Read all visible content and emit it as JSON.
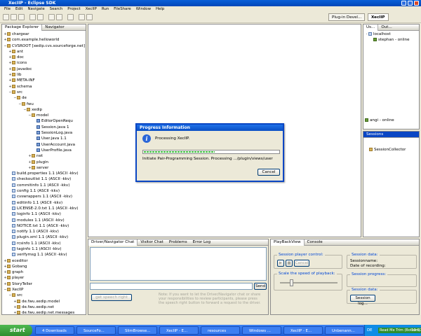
{
  "window": {
    "title": "XecIIP - Eclipse SDK"
  },
  "menu": [
    "File",
    "Edit",
    "Navigate",
    "Search",
    "Project",
    "XecIIP",
    "Run",
    "FileShare",
    "Window",
    "Help"
  ],
  "toolbar": {
    "perspective_active": "XecIIP",
    "perspective_other": "Plug-in Devel..."
  },
  "package_explorer": {
    "tabs": [
      "Package Explorer",
      "Navigator"
    ],
    "rows": [
      {
        "indent": 0,
        "exp": "+",
        "kind": "p",
        "label": "chargear"
      },
      {
        "indent": 0,
        "exp": "+",
        "kind": "p",
        "label": "com.example.helloworld"
      },
      {
        "indent": 0,
        "exp": "-",
        "kind": "p",
        "label": "CVSROOT  [xedip.cvs.sourceforge.net]"
      },
      {
        "indent": 1,
        "exp": "+",
        "kind": "p",
        "label": "ant"
      },
      {
        "indent": 1,
        "exp": "+",
        "kind": "p",
        "label": "doc"
      },
      {
        "indent": 1,
        "exp": "+",
        "kind": "p",
        "label": "icons"
      },
      {
        "indent": 1,
        "exp": "+",
        "kind": "p",
        "label": "javadoc"
      },
      {
        "indent": 1,
        "exp": "+",
        "kind": "p",
        "label": "lib"
      },
      {
        "indent": 1,
        "exp": "+",
        "kind": "p",
        "label": "META-INF"
      },
      {
        "indent": 1,
        "exp": "+",
        "kind": "p",
        "label": "schema"
      },
      {
        "indent": 1,
        "exp": "-",
        "kind": "p",
        "label": "src"
      },
      {
        "indent": 2,
        "exp": "-",
        "kind": "p",
        "label": "de"
      },
      {
        "indent": 3,
        "exp": "-",
        "kind": "p",
        "label": "fwu"
      },
      {
        "indent": 4,
        "exp": "-",
        "kind": "p",
        "label": "xedip"
      },
      {
        "indent": 5,
        "exp": "-",
        "kind": "p",
        "label": "model"
      },
      {
        "indent": 6,
        "exp": " ",
        "kind": "j",
        "label": "EditorOpenRequ"
      },
      {
        "indent": 6,
        "exp": " ",
        "kind": "j",
        "label": "Session.java 1"
      },
      {
        "indent": 6,
        "exp": " ",
        "kind": "j",
        "label": "SessionLog.java"
      },
      {
        "indent": 6,
        "exp": " ",
        "kind": "j",
        "label": "User.java 1.1"
      },
      {
        "indent": 6,
        "exp": " ",
        "kind": "j",
        "label": "UserAccount.java"
      },
      {
        "indent": 6,
        "exp": " ",
        "kind": "j",
        "label": "UserProfile.java"
      },
      {
        "indent": 5,
        "exp": "+",
        "kind": "p",
        "label": "net"
      },
      {
        "indent": 5,
        "exp": "+",
        "kind": "p",
        "label": "plugin"
      },
      {
        "indent": 5,
        "exp": "+",
        "kind": "p",
        "label": "server"
      },
      {
        "indent": 1,
        "exp": " ",
        "kind": "f",
        "label": "build.properties  1.1  (ASCII -kkv)"
      },
      {
        "indent": 1,
        "exp": " ",
        "kind": "f",
        "label": "checkoutlist  1.1  (ASCII -kkv)"
      },
      {
        "indent": 1,
        "exp": " ",
        "kind": "f",
        "label": "commitinfo  1.1  (ASCII -kkv)"
      },
      {
        "indent": 1,
        "exp": " ",
        "kind": "f",
        "label": "config  1.1  (ASCII -kkv)"
      },
      {
        "indent": 1,
        "exp": " ",
        "kind": "f",
        "label": "cvswrappers  1.1  (ASCII -kkv)"
      },
      {
        "indent": 1,
        "exp": " ",
        "kind": "f",
        "label": "editinfo  1.1  (ASCII -kkv)"
      },
      {
        "indent": 1,
        "exp": " ",
        "kind": "f",
        "label": "LICENSE-2.0.txt  1.1  (ASCII -kkv)"
      },
      {
        "indent": 1,
        "exp": " ",
        "kind": "f",
        "label": "loginfo  1.1  (ASCII -kkv)"
      },
      {
        "indent": 1,
        "exp": " ",
        "kind": "f",
        "label": "modules  1.1  (ASCII -kkv)"
      },
      {
        "indent": 1,
        "exp": " ",
        "kind": "f",
        "label": "NOTICE.txt  1.1  (ASCII -kkv)"
      },
      {
        "indent": 1,
        "exp": " ",
        "kind": "f",
        "label": "notify  1.1  (ASCII -kkv)"
      },
      {
        "indent": 1,
        "exp": " ",
        "kind": "f",
        "label": "plugin.xml  1.1  (ASCII -kkv)"
      },
      {
        "indent": 1,
        "exp": " ",
        "kind": "f",
        "label": "rcsinfo  1.1  (ASCII -kkv)"
      },
      {
        "indent": 1,
        "exp": " ",
        "kind": "f",
        "label": "taginfo  1.1  (ASCII -kkv)"
      },
      {
        "indent": 1,
        "exp": " ",
        "kind": "f",
        "label": "verifymsg  1.1  (ASCII -kkv)"
      },
      {
        "indent": 0,
        "exp": "+",
        "kind": "p",
        "label": "eceditor"
      },
      {
        "indent": 0,
        "exp": "+",
        "kind": "p",
        "label": "Gobang"
      },
      {
        "indent": 0,
        "exp": "+",
        "kind": "p",
        "label": "graph"
      },
      {
        "indent": 0,
        "exp": "+",
        "kind": "p",
        "label": "player"
      },
      {
        "indent": 0,
        "exp": "+",
        "kind": "p",
        "label": "StoryTeller"
      },
      {
        "indent": 0,
        "exp": "-",
        "kind": "p",
        "label": "XecIIP"
      },
      {
        "indent": 1,
        "exp": "-",
        "kind": "p",
        "label": "src"
      },
      {
        "indent": 2,
        "exp": "+",
        "kind": "p",
        "label": "de.fwu.xedip.model"
      },
      {
        "indent": 2,
        "exp": "+",
        "kind": "p",
        "label": "de.fwu.xedip.net"
      },
      {
        "indent": 2,
        "exp": "+",
        "kind": "p",
        "label": "de.fwu.xedip.net.messages"
      }
    ]
  },
  "users_view": {
    "tabs": [
      "Us...",
      "Out..."
    ],
    "host": "localhost",
    "user_online": "stephan - online",
    "user2_online": "angi - online"
  },
  "sessions_view": {
    "tab": "Sessions",
    "item": "SessionCollector"
  },
  "dialog": {
    "title": "Progress Information",
    "message": "Processing XecIIP.",
    "progress_pct": 52,
    "detail": "Initiate Pair-Programming Session. Processing .../plugin/views/user",
    "cancel_label": "Cancel"
  },
  "chat_panel": {
    "tabs": [
      "Driver/Navigator Chat",
      "Visitor Chat",
      "Problems",
      "Error Log"
    ],
    "send_label": "Send",
    "speech_right_label": "get speech right",
    "hint": "Note: If you want to let the Driver/Navigator chat or share your responsibilities to review participants, please press the speech right button to forward a request to the driver."
  },
  "playback_panel": {
    "tabs": [
      "PlayBackView",
      "Console"
    ],
    "control_title": "Session player control:",
    "play_label": "",
    "stop_label": "",
    "cancel_label": "Cancel",
    "speed_title": "Scale the speed of playback:",
    "data_title": "Session data:",
    "session_name_label": "Sessionname:",
    "date_label": "Date of recording:",
    "progress_title": "Session progress:",
    "data2_title": "Session data:",
    "session_log_label": "Session log..."
  },
  "taskbar": {
    "start": "start",
    "tasks": [
      "4 Downloads",
      "SourceFo...",
      "SlimBrowse...",
      "XecIIP - E...",
      "resources",
      "Windows ...",
      "XecIIP - E...",
      "Unbenann..."
    ],
    "lang": "DE",
    "tray_label": "Read Me Trim (Bottom)",
    "clock": "10:57"
  },
  "colors": {
    "accent": "#0a46c4",
    "taskbar": "#245edb",
    "start": "#3a9a3a"
  }
}
